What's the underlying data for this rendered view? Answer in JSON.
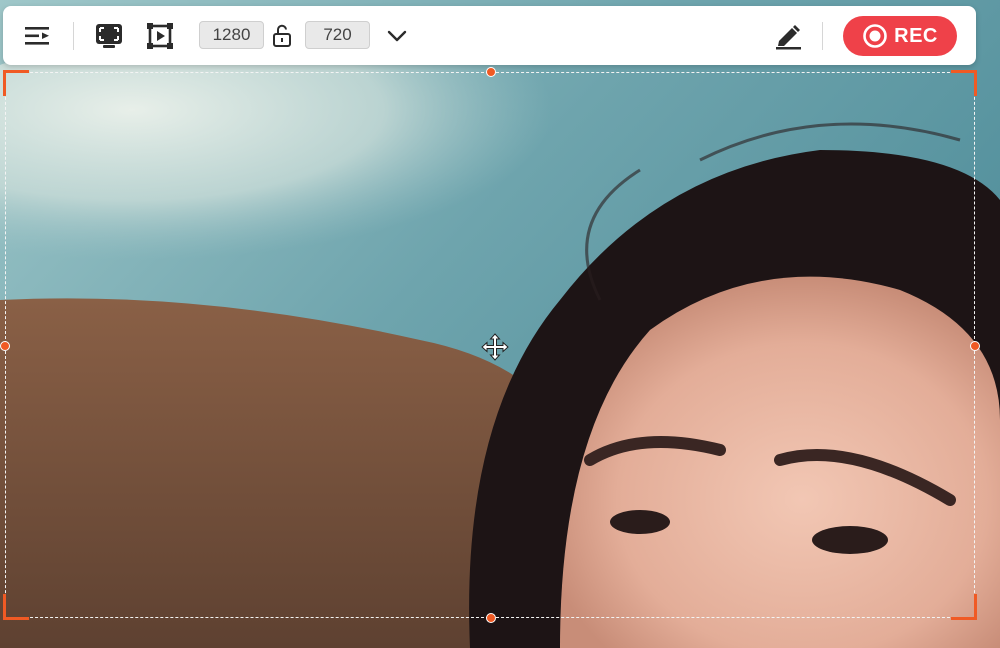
{
  "toolbar": {
    "width_value": "1280",
    "height_value": "720",
    "rec_label": "REC",
    "icons": {
      "menu": "menu-play-icon",
      "fullscreen": "fullscreen-region-icon",
      "custom_region": "custom-region-icon",
      "lock": "aspect-lock-icon",
      "dropdown": "chevron-down-icon",
      "annotate": "pen-annotate-icon",
      "record": "record-icon"
    }
  },
  "colors": {
    "accent": "#f05a24",
    "record": "#ef4149",
    "toolbar_bg": "#ffffff"
  }
}
